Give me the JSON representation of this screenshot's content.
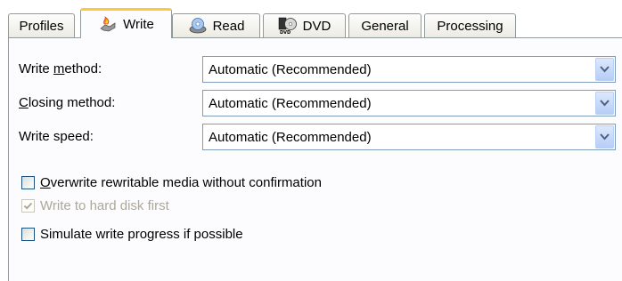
{
  "tabs": [
    {
      "label": "Profiles",
      "icon": "profiles"
    },
    {
      "label": "Write",
      "icon": "write-flame-icon",
      "active": true
    },
    {
      "label": "Read",
      "icon": "read-disc-icon"
    },
    {
      "label": "DVD",
      "icon": "dvd-icon"
    },
    {
      "label": "General"
    },
    {
      "label": "Processing"
    }
  ],
  "write_method": {
    "label_prefix": "Write ",
    "label_key": "m",
    "label_suffix": "ethod:",
    "value": "Automatic (Recommended)"
  },
  "closing_method": {
    "label_key": "C",
    "label_suffix": "losing method:",
    "value": "Automatic (Recommended)"
  },
  "write_speed": {
    "label": "Write speed:",
    "value": "Automatic (Recommended)"
  },
  "options": {
    "overwrite": {
      "label_key": "O",
      "label_suffix": "verwrite rewritable media without confirmation",
      "checked": false
    },
    "hard_disk": {
      "label": "Write to hard disk first",
      "checked": true,
      "enabled": false
    },
    "simulate": {
      "label": "Simulate write progress if possible",
      "checked": false
    }
  },
  "colors": {
    "tab_highlight": "#ffc83c",
    "border": "#919b9c",
    "combo_border": "#7f9db9"
  }
}
